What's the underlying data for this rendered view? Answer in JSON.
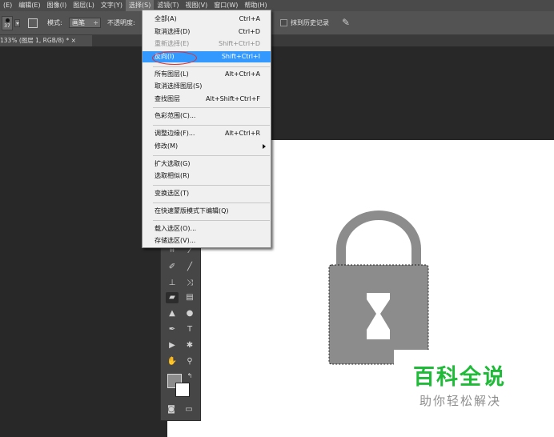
{
  "menubar": {
    "items": [
      "(E)",
      "编辑(E)",
      "图像(I)",
      "图层(L)",
      "文字(Y)",
      "选择(S)",
      "滤镜(T)",
      "视图(V)",
      "窗口(W)",
      "帮助(H)"
    ],
    "active_index": 5
  },
  "options": {
    "brush_size": "37",
    "mode_label": "模式:",
    "mode_value": "画笔",
    "opacity_label": "不透明度:",
    "erase_history_label": "抹到历史记录"
  },
  "document": {
    "tab_title": "133% (图层 1, RGB/8) * ×"
  },
  "select_menu": {
    "items": [
      {
        "label": "全部(A)",
        "shortcut": "Ctrl+A"
      },
      {
        "label": "取消选择(D)",
        "shortcut": "Ctrl+D"
      },
      {
        "label": "重新选择(E)",
        "shortcut": "Shift+Ctrl+D",
        "disabled": true
      },
      {
        "label": "反向(I)",
        "shortcut": "Shift+Ctrl+I",
        "highlighted": true
      },
      {
        "label": "所有图层(L)",
        "shortcut": "Alt+Ctrl+A"
      },
      {
        "label": "取消选择图层(S)",
        "shortcut": ""
      },
      {
        "label": "查找图层",
        "shortcut": "Alt+Shift+Ctrl+F"
      },
      {
        "label": "色彩范围(C)...",
        "shortcut": ""
      },
      {
        "label": "调整边缘(F)...",
        "shortcut": "Alt+Ctrl+R"
      },
      {
        "label": "修改(M)",
        "shortcut": "",
        "submenu": true
      },
      {
        "label": "扩大选取(G)",
        "shortcut": ""
      },
      {
        "label": "选取相似(R)",
        "shortcut": ""
      },
      {
        "label": "变换选区(T)",
        "shortcut": ""
      },
      {
        "label": "在快速蒙版模式下编辑(Q)",
        "shortcut": ""
      },
      {
        "label": "载入选区(O)...",
        "shortcut": ""
      },
      {
        "label": "存储选区(V)...",
        "shortcut": ""
      }
    ]
  },
  "toolbox": {
    "tools": [
      "crop-icon",
      "eyedropper-icon",
      "healing-brush-icon",
      "brush-icon",
      "clone-stamp-icon",
      "history-brush-icon",
      "eraser-icon",
      "gradient-icon",
      "blur-icon",
      "dodge-icon",
      "pen-icon",
      "type-icon",
      "path-selection-icon",
      "shape-icon",
      "hand-icon",
      "zoom-icon",
      "color-swatches-icon",
      "quick-mask-icon",
      "screen-mode-icon"
    ],
    "active_tool": "eraser-icon",
    "foreground_color": "#8c8c8c",
    "background_color": "#ffffff"
  },
  "artwork": {
    "lock_body_color": "#8c8c8c",
    "shackle_color": "#8c8c8c",
    "keyhole_color": "#ffffff"
  },
  "watermark": {
    "title": "百科全说",
    "subtitle": "助你轻松解决",
    "title_color": "#1fbb38"
  }
}
